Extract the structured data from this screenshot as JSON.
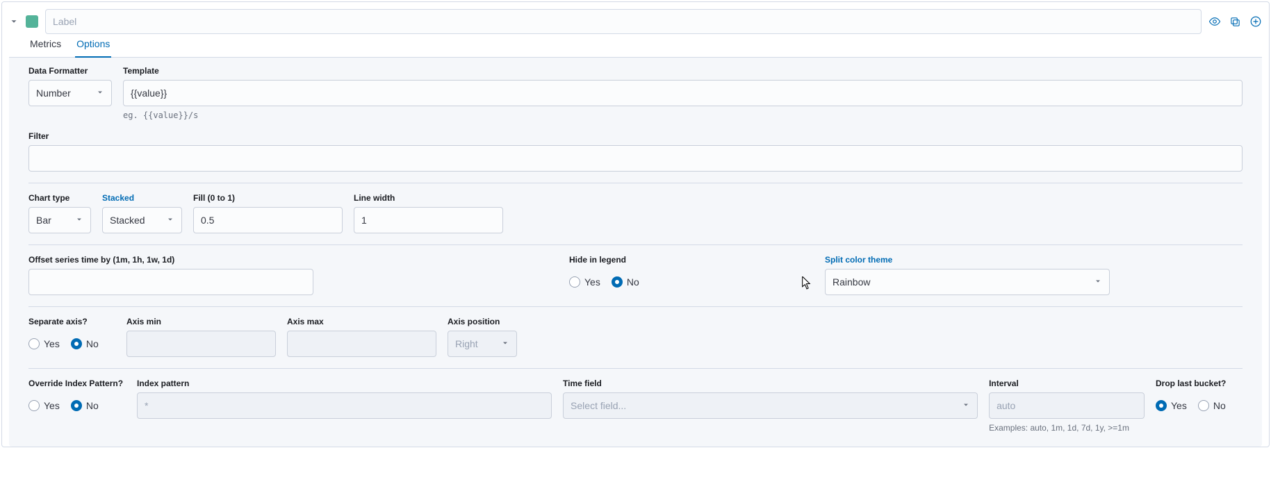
{
  "header": {
    "label_placeholder": "Label",
    "color": "#54b399"
  },
  "tabs": [
    {
      "id": "metrics",
      "label": "Metrics",
      "active": false
    },
    {
      "id": "options",
      "label": "Options",
      "active": true
    }
  ],
  "options": {
    "data_formatter": {
      "label": "Data Formatter",
      "value": "Number"
    },
    "template": {
      "label": "Template",
      "value": "{{value}}",
      "hint": "eg. {{value}}/s"
    },
    "filter": {
      "label": "Filter",
      "value": ""
    },
    "chart_type": {
      "label": "Chart type",
      "value": "Bar"
    },
    "stacked": {
      "label": "Stacked",
      "value": "Stacked"
    },
    "fill": {
      "label": "Fill (0 to 1)",
      "value": "0.5"
    },
    "line_width": {
      "label": "Line width",
      "value": "1"
    },
    "offset": {
      "label": "Offset series time by (1m, 1h, 1w, 1d)",
      "value": ""
    },
    "hide_in_legend": {
      "label": "Hide in legend",
      "yes": "Yes",
      "no": "No",
      "value": "No"
    },
    "split_color_theme": {
      "label": "Split color theme",
      "value": "Rainbow"
    },
    "separate_axis": {
      "label": "Separate axis?",
      "yes": "Yes",
      "no": "No",
      "value": "No"
    },
    "axis_min": {
      "label": "Axis min",
      "value": ""
    },
    "axis_max": {
      "label": "Axis max",
      "value": ""
    },
    "axis_position": {
      "label": "Axis position",
      "value": "Right"
    },
    "override_index": {
      "label": "Override Index Pattern?",
      "yes": "Yes",
      "no": "No",
      "value": "No"
    },
    "index_pattern": {
      "label": "Index pattern",
      "placeholder": "*",
      "value": ""
    },
    "time_field": {
      "label": "Time field",
      "placeholder": "Select field...",
      "value": ""
    },
    "interval": {
      "label": "Interval",
      "placeholder": "auto",
      "value": "",
      "hint": "Examples: auto, 1m, 1d, 7d, 1y, >=1m"
    },
    "drop_last_bucket": {
      "label": "Drop last bucket?",
      "yes": "Yes",
      "no": "No",
      "value": "Yes"
    }
  }
}
